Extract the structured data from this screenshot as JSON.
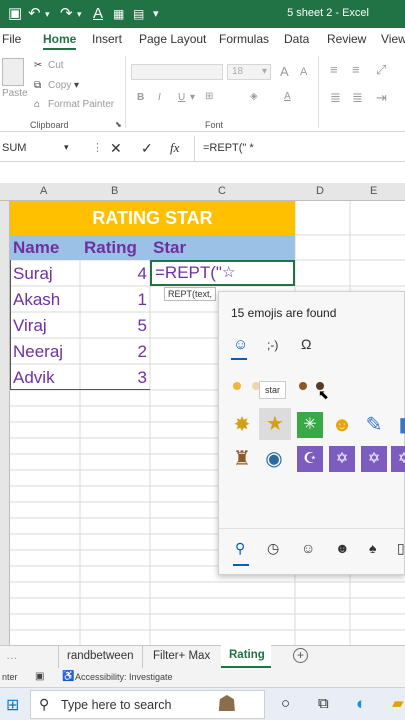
{
  "titlebar": {
    "title": "5 sheet 2  -  Excel"
  },
  "tabs": [
    "File",
    "Home",
    "Insert",
    "Page Layout",
    "Formulas",
    "Data",
    "Review",
    "View"
  ],
  "clipboard": {
    "paste": "Paste",
    "cut": "Cut",
    "copy": "Copy",
    "format_painter": "Format Painter",
    "group": "Clipboard"
  },
  "font": {
    "size": "18",
    "group": "Font"
  },
  "formula_bar": {
    "name_box": "SUM",
    "fx": "fx",
    "formula": "=REPT(\" *"
  },
  "columns": [
    "A",
    "B",
    "C",
    "D",
    "E"
  ],
  "sheet": {
    "banner": "RATING STAR",
    "headers": {
      "name": "Name",
      "rating": "Rating",
      "star": "Star"
    },
    "rows": [
      {
        "name": "Suraj",
        "rating": "4"
      },
      {
        "name": "Akash",
        "rating": "1"
      },
      {
        "name": "Viraj",
        "rating": "5"
      },
      {
        "name": "Neeraj",
        "rating": "2"
      },
      {
        "name": "Advik",
        "rating": "3"
      }
    ],
    "edit_text": "=REPT(\"",
    "tooltip": "REPT(text, "
  },
  "emoji_panel": {
    "count_text": "15 emojis are found",
    "hover_label": "star"
  },
  "sheet_tabs": [
    "randbetween",
    "Filter+ Max",
    "Rating"
  ],
  "status": {
    "left": "nter",
    "accessibility": "Accessibility: Investigate"
  },
  "taskbar": {
    "search_placeholder": "Type here to search"
  },
  "colors": {
    "excel_green": "#217346",
    "banner": "#ffc000",
    "header_fill": "#9bc2e6",
    "text_purple": "#7030a0"
  }
}
